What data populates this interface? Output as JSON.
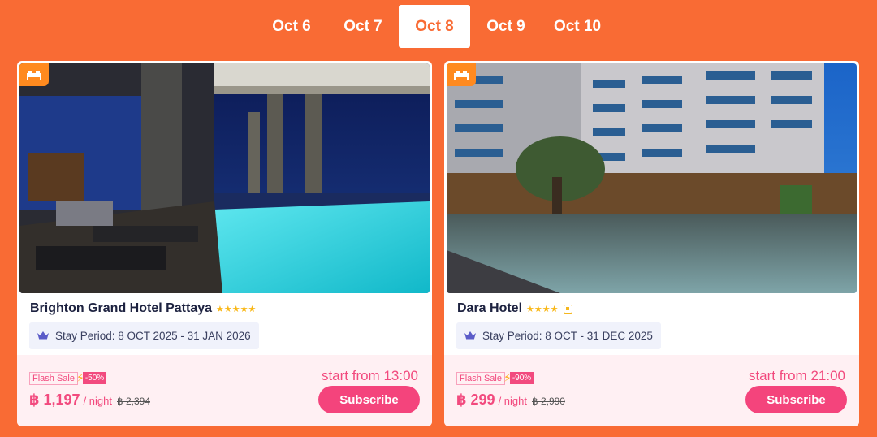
{
  "tabs": [
    {
      "label": "Oct 6",
      "active": false
    },
    {
      "label": "Oct 7",
      "active": false
    },
    {
      "label": "Oct 8",
      "active": true
    },
    {
      "label": "Oct 9",
      "active": false
    },
    {
      "label": "Oct 10",
      "active": false
    }
  ],
  "colors": {
    "background": "#f96b34",
    "accent": "#f4447c",
    "star": "#f9b716"
  },
  "hotels": [
    {
      "name": "Brighton Grand Hotel Pattaya",
      "stars": "★★★★★",
      "stay_period": "Stay Period: 8 OCT 2025 - 31 JAN 2026",
      "flash_label": "Flash Sale",
      "discount": "-50%",
      "price": "฿ 1,197",
      "per_night": "/ night",
      "old_price": "฿ 2,394",
      "start_time": "start from 13:00",
      "subscribe": "Subscribe"
    },
    {
      "name": "Dara Hotel",
      "stars": "★★★★",
      "stay_period": "Stay Period: 8 OCT - 31 DEC 2025",
      "flash_label": "Flash Sale",
      "discount": "-90%",
      "price": "฿ 299",
      "per_night": "/ night",
      "old_price": "฿ 2,990",
      "start_time": "start from 21:00",
      "subscribe": "Subscribe"
    }
  ]
}
